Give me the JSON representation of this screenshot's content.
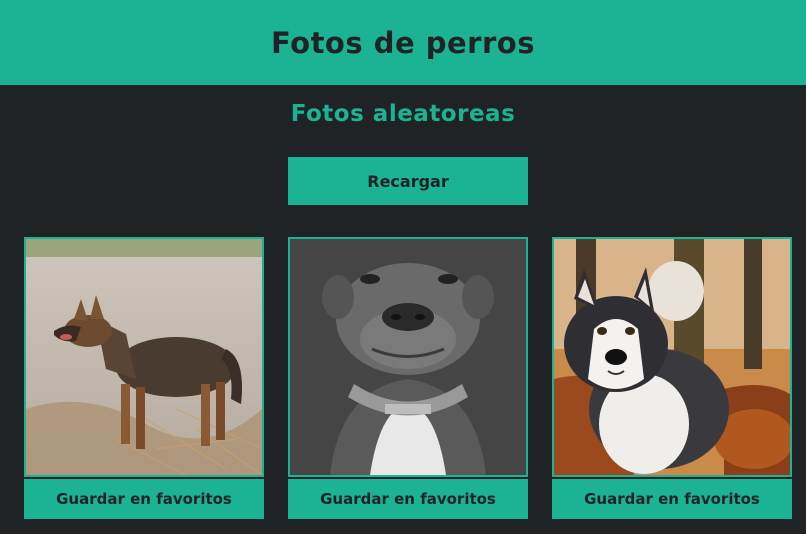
{
  "header": {
    "title": "Fotos de perros"
  },
  "main": {
    "subtitle": "Fotos aleatoreas",
    "reload_label": "Recargar"
  },
  "cards": [
    {
      "favorite_label": "Guardar en favoritos",
      "image_icon": "shepherd-dog-photo"
    },
    {
      "favorite_label": "Guardar en favoritos",
      "image_icon": "pitbull-dog-photo"
    },
    {
      "favorite_label": "Guardar en favoritos",
      "image_icon": "malamute-dog-photo"
    }
  ],
  "colors": {
    "accent": "#1bb394",
    "background": "#1f2326",
    "text_dark": "#1f2326"
  }
}
